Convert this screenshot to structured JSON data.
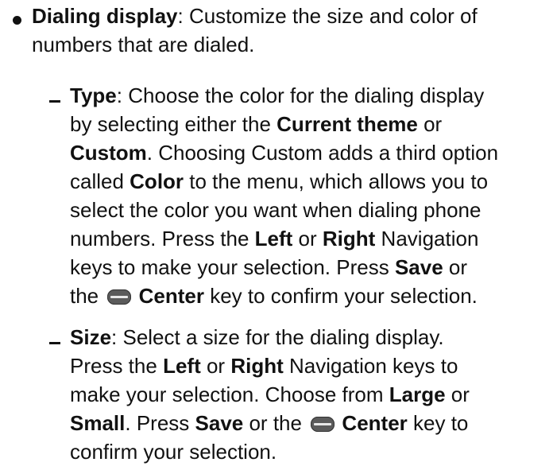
{
  "dialing_display": {
    "title": "Dialing display",
    "intro_rest": ": Customize the size and color of",
    "intro_line2": "numbers that are dialed."
  },
  "type_item": {
    "label": "Type",
    "l1_rest": ": Choose the color for the dialing display",
    "l2_a": "by selecting either the ",
    "l2_current_theme": "Current theme",
    "l2_b": " or",
    "l3_custom": "Custom",
    "l3_rest": ". Choosing Custom adds a third option",
    "l4_a": "called ",
    "l4_color": "Color",
    "l4_rest": " to the menu, which allows you to",
    "l5": "select the color you want when dialing phone",
    "l6_a": "numbers. Press the ",
    "l6_left": "Left",
    "l6_or": " or ",
    "l6_right": "Right",
    "l6_rest": " Navigation",
    "l7_a": "keys to make your selection. Press ",
    "l7_save": "Save",
    "l7_b": " or",
    "l8_a": "the ",
    "l8_center": "Center",
    "l8_rest": " key to confirm your selection."
  },
  "size_item": {
    "label": "Size",
    "l1_rest": ": Select a size for the dialing display.",
    "l2_a": "Press the ",
    "l2_left": "Left",
    "l2_or": " or ",
    "l2_right": "Right",
    "l2_rest": " Navigation keys to",
    "l3_a": "make your selection. Choose from ",
    "l3_large": "Large",
    "l3_b": " or",
    "l4_small": "Small",
    "l4_a": ". Press ",
    "l4_save": "Save",
    "l4_b": " or the ",
    "l4_center": "Center",
    "l4_rest": " key to",
    "l5": "confirm your selection."
  },
  "icons": {
    "center_key": "center-key-icon",
    "bullet": "bullet-icon",
    "dash": "dash-icon"
  },
  "colors": {
    "text": "#111111",
    "center_key_icon": "#5b5b5b"
  }
}
